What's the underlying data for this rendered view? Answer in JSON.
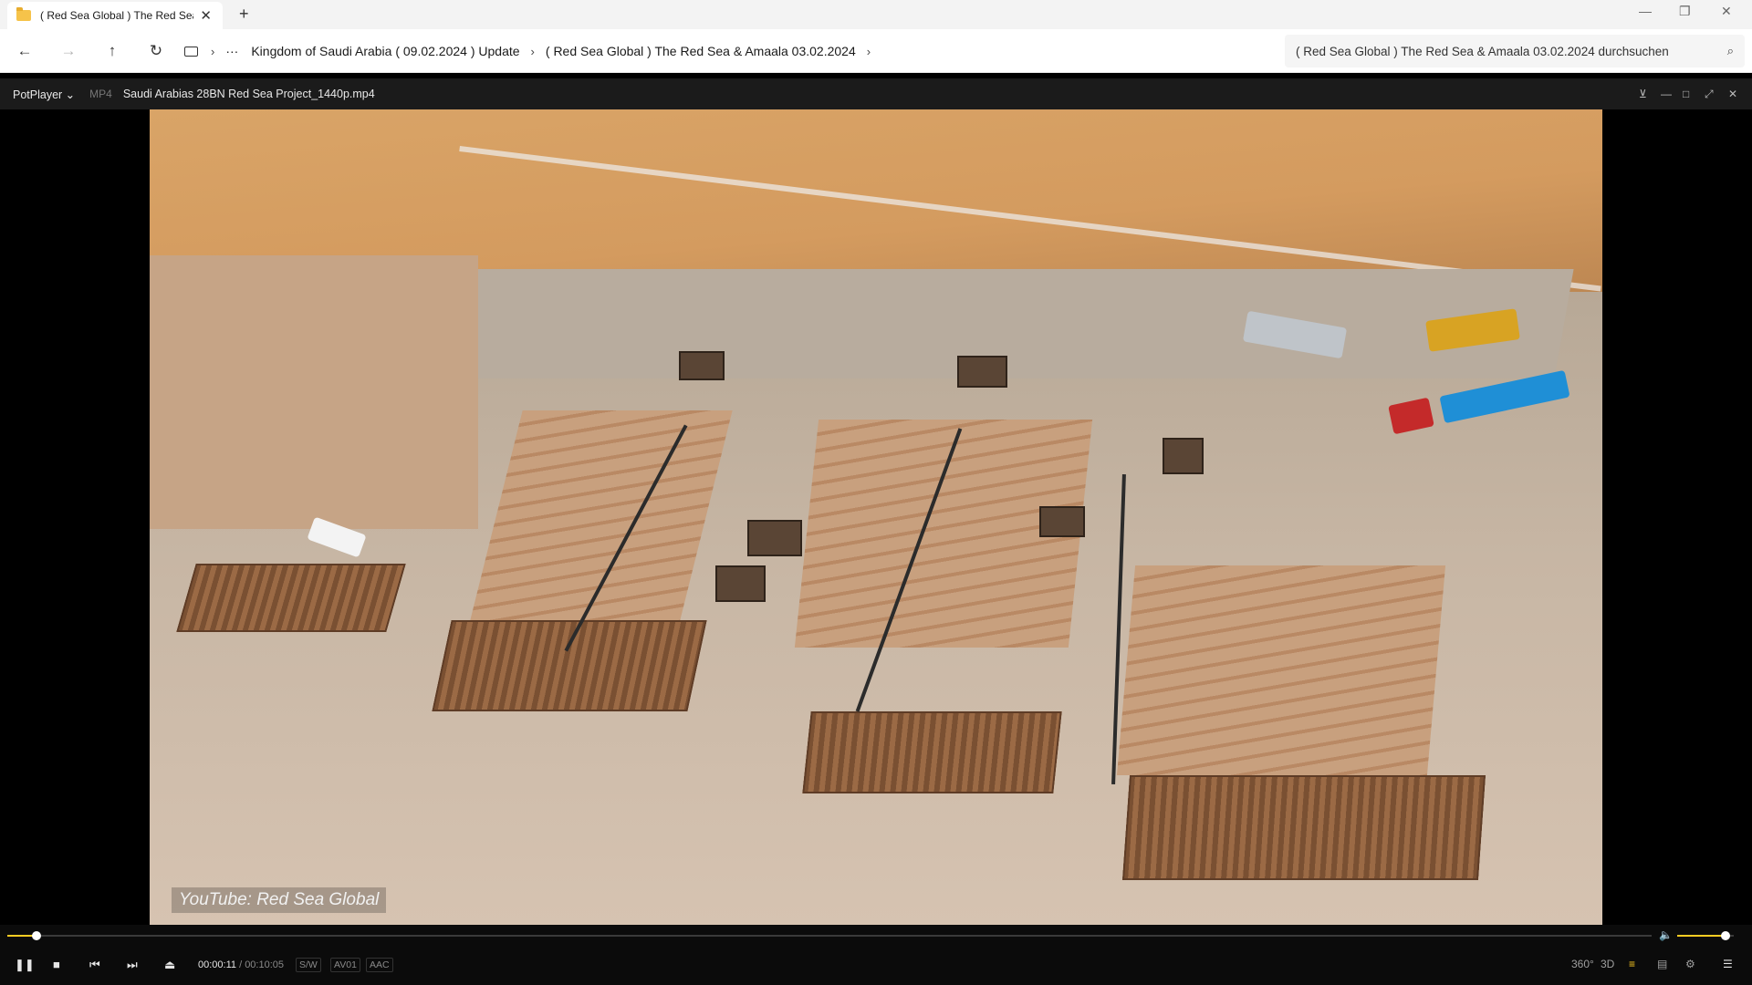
{
  "explorer": {
    "tab_title": "( Red Sea Global ) The Red Sea",
    "new_tab": "+",
    "close_tab": "✕",
    "window_controls": {
      "minimize": "—",
      "maximize": "❐",
      "close": "✕"
    },
    "nav": {
      "back": "←",
      "forward": "→",
      "up": "↑",
      "refresh": "↻",
      "more": "···"
    },
    "breadcrumbs": [
      "Kingdom of Saudi Arabia ( 09.02.2024 ) Update",
      "( Red Sea Global ) The Red Sea & Amaala 03.02.2024"
    ],
    "search_placeholder": "( Red Sea Global ) The Red Sea & Amaala 03.02.2024 durchsuchen"
  },
  "player": {
    "app_menu": "PotPlayer ⌄",
    "format": "MP4",
    "filename": "Saudi Arabias 28BN Red Sea Project_1440p.mp4",
    "watermark": "YouTube: Red Sea Global",
    "time_current": "00:00:11",
    "time_sep": " / ",
    "time_total": "00:10:05",
    "tags": {
      "sw": "S/W",
      "av": "AV01",
      "aac": "AAC"
    },
    "progress": 0.018,
    "volume": 0.85,
    "right_icons": {
      "vr": "360°",
      "three_d": "3D",
      "playlist": "≡",
      "chapters": "▤",
      "settings": "⚙",
      "menu": "☰"
    },
    "accent_color": "#ffcc22"
  }
}
